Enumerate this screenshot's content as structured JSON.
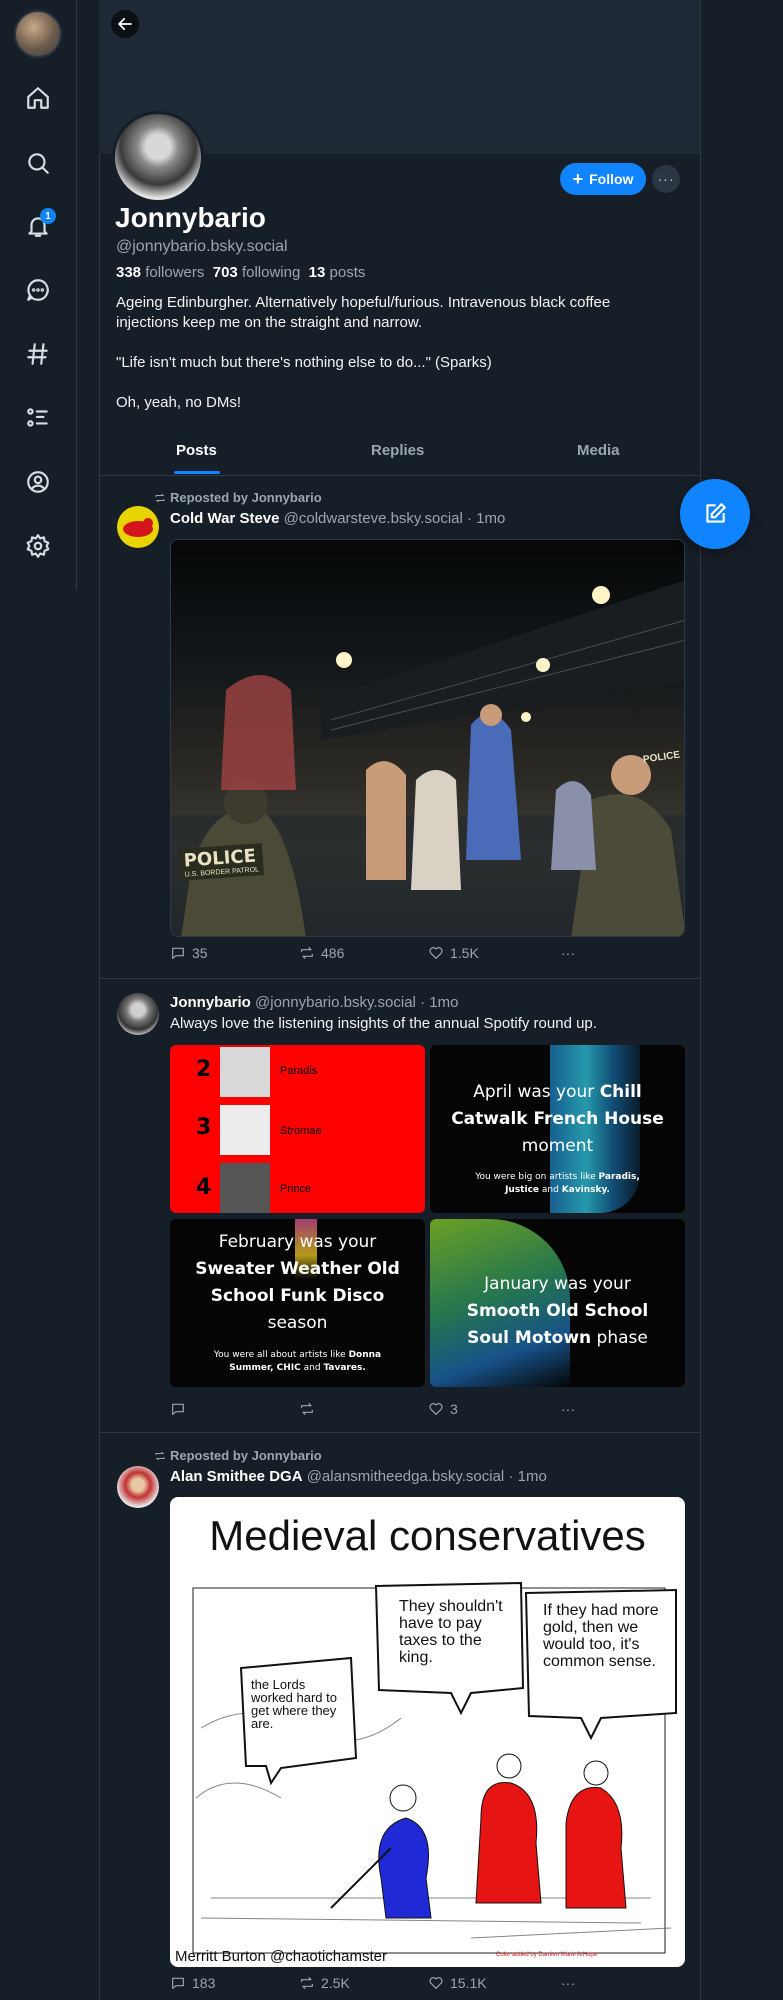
{
  "profile": {
    "display_name": "Jonnybario",
    "handle": "@jonnybario.bsky.social",
    "followers_count": "338",
    "followers_label": "followers",
    "following_count": "703",
    "following_label": "following",
    "posts_count": "13",
    "posts_label": "posts",
    "bio": [
      "Ageing Edinburgher. Alternatively hopeful/furious. Intravenous black coffee injections keep me on the straight and narrow.",
      "\"Life isn't much but there's nothing else to do...\" (Sparks)",
      "Oh, yeah, no DMs!"
    ],
    "follow_label": "Follow",
    "more_label": "···"
  },
  "nav": {
    "notifications_badge": "1"
  },
  "tabs": [
    "Posts",
    "Replies",
    "Media"
  ],
  "colors": {
    "accent": "#1083fe",
    "background": "#161e27",
    "muted": "#9aa6b2"
  },
  "posts": [
    {
      "repost_label": "Reposted by Jonnybario",
      "author": "Cold War Steve",
      "handle": "@coldwarsteve.bsky.social",
      "time": "· 1mo",
      "replies": "35",
      "reposts": "486",
      "likes": "1.5K",
      "image": {
        "badge_left": "POLICE",
        "badge_left_sub": "U.S. BORDER PATROL",
        "badge_right": "POLICE"
      }
    },
    {
      "author": "Jonnybario",
      "handle": "@jonnybario.bsky.social",
      "time": "· 1mo",
      "text": "Always love the listening insights of the annual Spotify round up.",
      "replies": "",
      "reposts": "",
      "likes": "3",
      "tiles": {
        "ranks": [
          {
            "num": "2",
            "artist": "Paradis"
          },
          {
            "num": "3",
            "artist": "Stromae"
          },
          {
            "num": "4",
            "artist": "Prince"
          }
        ],
        "april": {
          "line1": "April was your",
          "bold1": "Chill",
          "bold2": "Catwalk French House",
          "line3": "moment",
          "small": "You were big on artists like",
          "small_b1": "Paradis,",
          "small_b2": "Justice",
          "small_and": "and",
          "small_b3": "Kavinsky."
        },
        "february": {
          "line1": "February was your",
          "bold1": "Sweater Weather Old",
          "bold2": "School Funk Disco",
          "line3": "season",
          "small": "You were all about artists like",
          "small_b1": "Donna",
          "small_b2": "Summer, CHIC",
          "small_and": "and",
          "small_b3": "Tavares."
        },
        "january": {
          "line1": "January was your",
          "bold1": "Smooth Old School",
          "bold2": "Soul Motown",
          "line3": "phase"
        }
      }
    },
    {
      "repost_label": "Reposted by Jonnybario",
      "author": "Alan Smithee DGA",
      "handle": "@alansmitheedga.bsky.social",
      "time": "· 1mo",
      "replies": "183",
      "reposts": "2.5K",
      "likes": "15.1K",
      "cartoon": {
        "title": "Medieval conservatives",
        "bubble1": "the Lords worked hard to get where they are.",
        "bubble2": "They shouldn't have to pay taxes to the king.",
        "bubble3": "If they had more gold, then we would too, it's common sense.",
        "credit": "Merritt Burton @chaotichamster",
        "color_credit": "Color added by Damien Marie AtHope"
      }
    }
  ]
}
